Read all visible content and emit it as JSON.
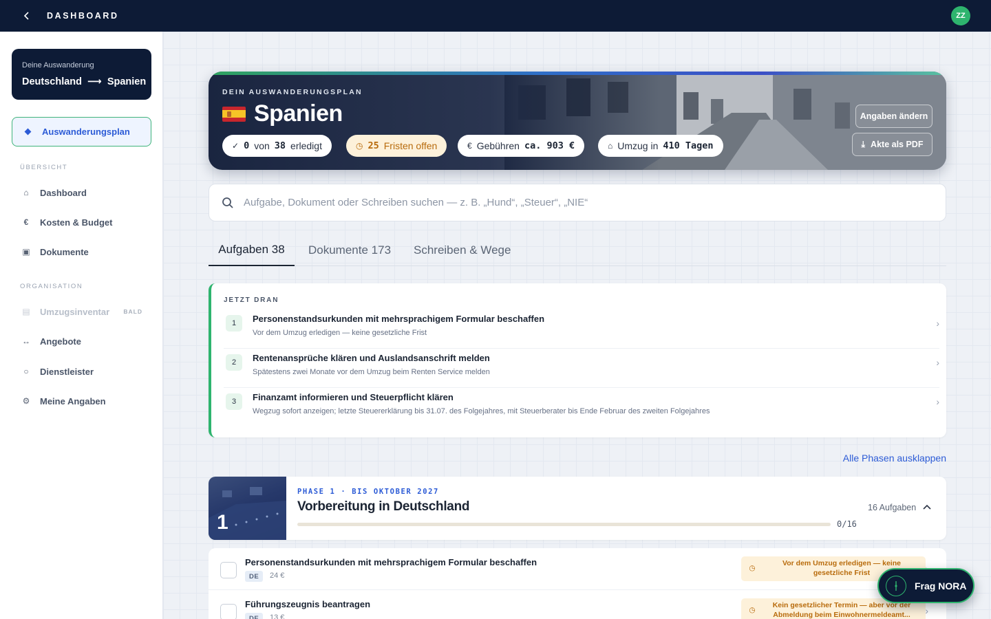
{
  "topbar": {
    "title": "DASHBOARD",
    "avatar": "ZZ"
  },
  "sidebar": {
    "route_sub": "Deine Auswanderung",
    "route_from": "Deutschland",
    "route_arrow": "⟶",
    "route_to": "Spanien",
    "active_item": "Auswanderungsplan",
    "section_overview": "ÜBERSICHT",
    "overview_items": [
      {
        "label": "Dashboard",
        "icon": "home-icon"
      },
      {
        "label": "Kosten & Budget",
        "icon": "euro-icon"
      },
      {
        "label": "Dokumente",
        "icon": "document-icon"
      }
    ],
    "section_org": "ORGANISATION",
    "org_items": [
      {
        "label": "Umzugsinventar",
        "icon": "box-icon",
        "badge": "BALD",
        "disabled": true
      },
      {
        "label": "Angebote",
        "icon": "compare-icon"
      },
      {
        "label": "Dienstleister",
        "icon": "circle-icon"
      },
      {
        "label": "Meine Angaben",
        "icon": "settings-icon"
      }
    ]
  },
  "hero": {
    "eyebrow": "DEIN AUSWANDERUNGSPLAN",
    "country": "Spanien",
    "flag": "spain-flag",
    "done_count": "0",
    "done_of": "von",
    "done_total": "38",
    "done_label": "erledigt",
    "deadlines_count": "25",
    "deadlines_label": "Fristen offen",
    "fees_label": "Gebühren",
    "fees_value": "ca. 903 €",
    "move_label": "Umzug in",
    "move_value": "410 Tagen",
    "edit_button": "Angaben ändern",
    "pdf_button": "Akte als PDF"
  },
  "search": {
    "placeholder": "Aufgabe, Dokument oder Schreiben suchen — z. B. „Hund“, „Steuer“, „NIE“"
  },
  "tabs": [
    {
      "label": "Aufgaben 38",
      "active": true
    },
    {
      "label": "Dokumente 173",
      "active": false
    },
    {
      "label": "Schreiben & Wege",
      "active": false
    }
  ],
  "now": {
    "heading": "JETZT DRAN",
    "items": [
      {
        "num": "1",
        "title": "Personenstandsurkunden mit mehrsprachigem Formular beschaffen",
        "sub": "Vor dem Umzug erledigen — keine gesetzliche Frist"
      },
      {
        "num": "2",
        "title": "Rentenansprüche klären und Auslandsanschrift melden",
        "sub": "Spätestens zwei Monate vor dem Umzug beim Renten Service melden"
      },
      {
        "num": "3",
        "title": "Finanzamt informieren und Steuerpflicht klären",
        "sub": "Wegzug sofort anzeigen; letzte Steuererklärung bis 31.07. des Folgejahres, mit Steuerberater bis Ende Februar des zweiten Folgejahres"
      }
    ]
  },
  "expand_all": "Alle Phasen ausklappen",
  "phase": {
    "number": "1",
    "eyebrow": "PHASE 1 · BIS OKTOBER 2027",
    "title": "Vorbereitung in Deutschland",
    "count": "16 Aufgaben",
    "progress": "0/16",
    "progress_fraction": 0
  },
  "tasks": [
    {
      "title": "Personenstandsurkunden mit mehrsprachigem Formular beschaffen",
      "tag": "DE",
      "fee": "24 €",
      "deadline": "Vor dem Umzug erledigen — keine gesetzliche Frist"
    },
    {
      "title": "Führungszeugnis beantragen",
      "tag": "DE",
      "fee": "13 €",
      "deadline": "Kein gesetzlicher Termin — aber vor der Abmeldung beim Einwohnermeldeamt..."
    }
  ],
  "nora": {
    "label": "Frag NORA"
  },
  "colors": {
    "navy": "#0d1b36",
    "accent": "#2c5bd6",
    "green": "#2eb46e",
    "warning": "#b86b0c"
  }
}
